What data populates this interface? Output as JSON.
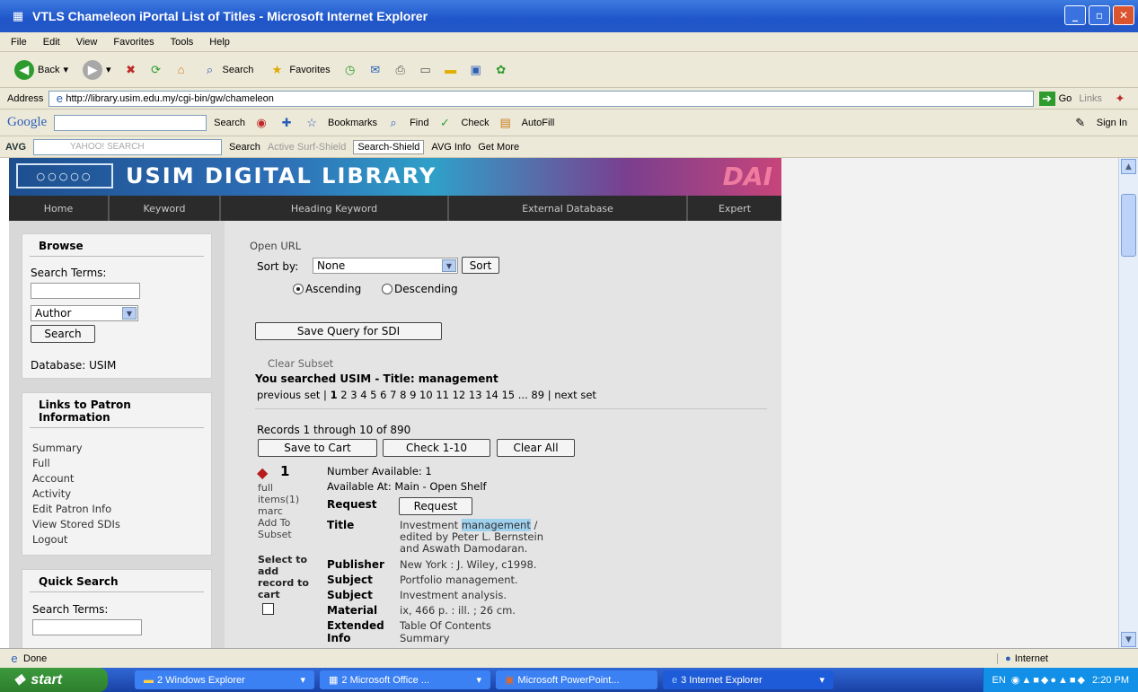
{
  "window": {
    "title": "VTLS Chameleon iPortal List of Titles - Microsoft Internet Explorer"
  },
  "menu": [
    "File",
    "Edit",
    "View",
    "Favorites",
    "Tools",
    "Help"
  ],
  "toolbar": {
    "back": "Back",
    "search": "Search",
    "favorites": "Favorites"
  },
  "address": {
    "label": "Address",
    "url": "http://library.usim.edu.my/cgi-bin/gw/chameleon",
    "go": "Go",
    "links": "Links"
  },
  "google": {
    "label": "Google",
    "search": "Search",
    "bookmarks": "Bookmarks",
    "find": "Find",
    "check": "Check",
    "autofill": "AutoFill",
    "signin": "Sign In"
  },
  "avg": {
    "label": "AVG",
    "yahoo": "YAHOO! SEARCH",
    "search": "Search",
    "surf": "Active Surf-Shield",
    "shield": "Search-Shield",
    "info": "AVG Info",
    "more": "Get More"
  },
  "site": {
    "logo": "○○○○○",
    "title": "USIM DIGITAL LIBRARY",
    "banner_text": "DAI",
    "nav": [
      "Home",
      "Keyword",
      "Heading Keyword",
      "External Database",
      "Expert"
    ]
  },
  "browse": {
    "title": "Browse",
    "search_terms": "Search Terms:",
    "search_value": "",
    "type": "Author",
    "search_btn": "Search",
    "database": "Database: USIM"
  },
  "patron": {
    "title": "Links to Patron Information",
    "links": [
      "Summary",
      "Full",
      "Account",
      "Activity",
      "Edit Patron Info",
      "View Stored SDIs",
      "Logout"
    ]
  },
  "quick": {
    "title": "Quick Search",
    "search_terms": "Search Terms:",
    "search_value": ""
  },
  "main": {
    "open_url": "Open URL",
    "sort_by": "Sort by:",
    "sort_value": "None",
    "sort_btn": "Sort",
    "ascending": "Ascending",
    "descending": "Descending",
    "save_query": "Save Query for SDI",
    "clear_subset": "Clear Subset",
    "you_searched": "You searched USIM - Title: management",
    "previous_set": "previous set |",
    "current_page": "1",
    "pages": "2 3 4 5 6 7 8 9 10 11 12 13 14 15 ... 89",
    "next_set": "| next set",
    "records": "Records 1 through 10 of 890",
    "save_cart": "Save to Cart",
    "check": "Check 1-10",
    "clear_all": "Clear All"
  },
  "record": {
    "num": "1",
    "full": "full",
    "items": "items(1)",
    "marc": "marc",
    "add_subset": "Add To Subset",
    "select_cart": "Select to add record to cart",
    "number_available": "Number Available: 1",
    "available_at": "Available At: Main - Open Shelf",
    "request_label": "Request",
    "request_btn": "Request",
    "title_label": "Title",
    "title_pre": "Investment ",
    "title_hl": "management",
    "title_post": " /",
    "title_l2": "edited by Peter L. Bernstein",
    "title_l3": "and Aswath Damodaran.",
    "publisher_label": "Publisher",
    "publisher": "New York : J. Wiley, c1998.",
    "subject_label": "Subject",
    "subject1": "Portfolio management.",
    "subject2": "Investment analysis.",
    "material_label": "Material",
    "material": "ix, 466 p. : ill. ; 26 cm.",
    "extended_label": "Extended",
    "extended_l2": "Info",
    "toc": "Table Of Contents",
    "summary": "Summary"
  },
  "status": {
    "done": "Done",
    "zone": "Internet"
  },
  "taskbar": {
    "start": "start",
    "tasks": [
      "2 Windows Explorer",
      "2 Microsoft Office ...",
      "Microsoft PowerPoint...",
      "3 Internet Explorer"
    ],
    "lang": "EN",
    "time": "2:20 PM"
  }
}
